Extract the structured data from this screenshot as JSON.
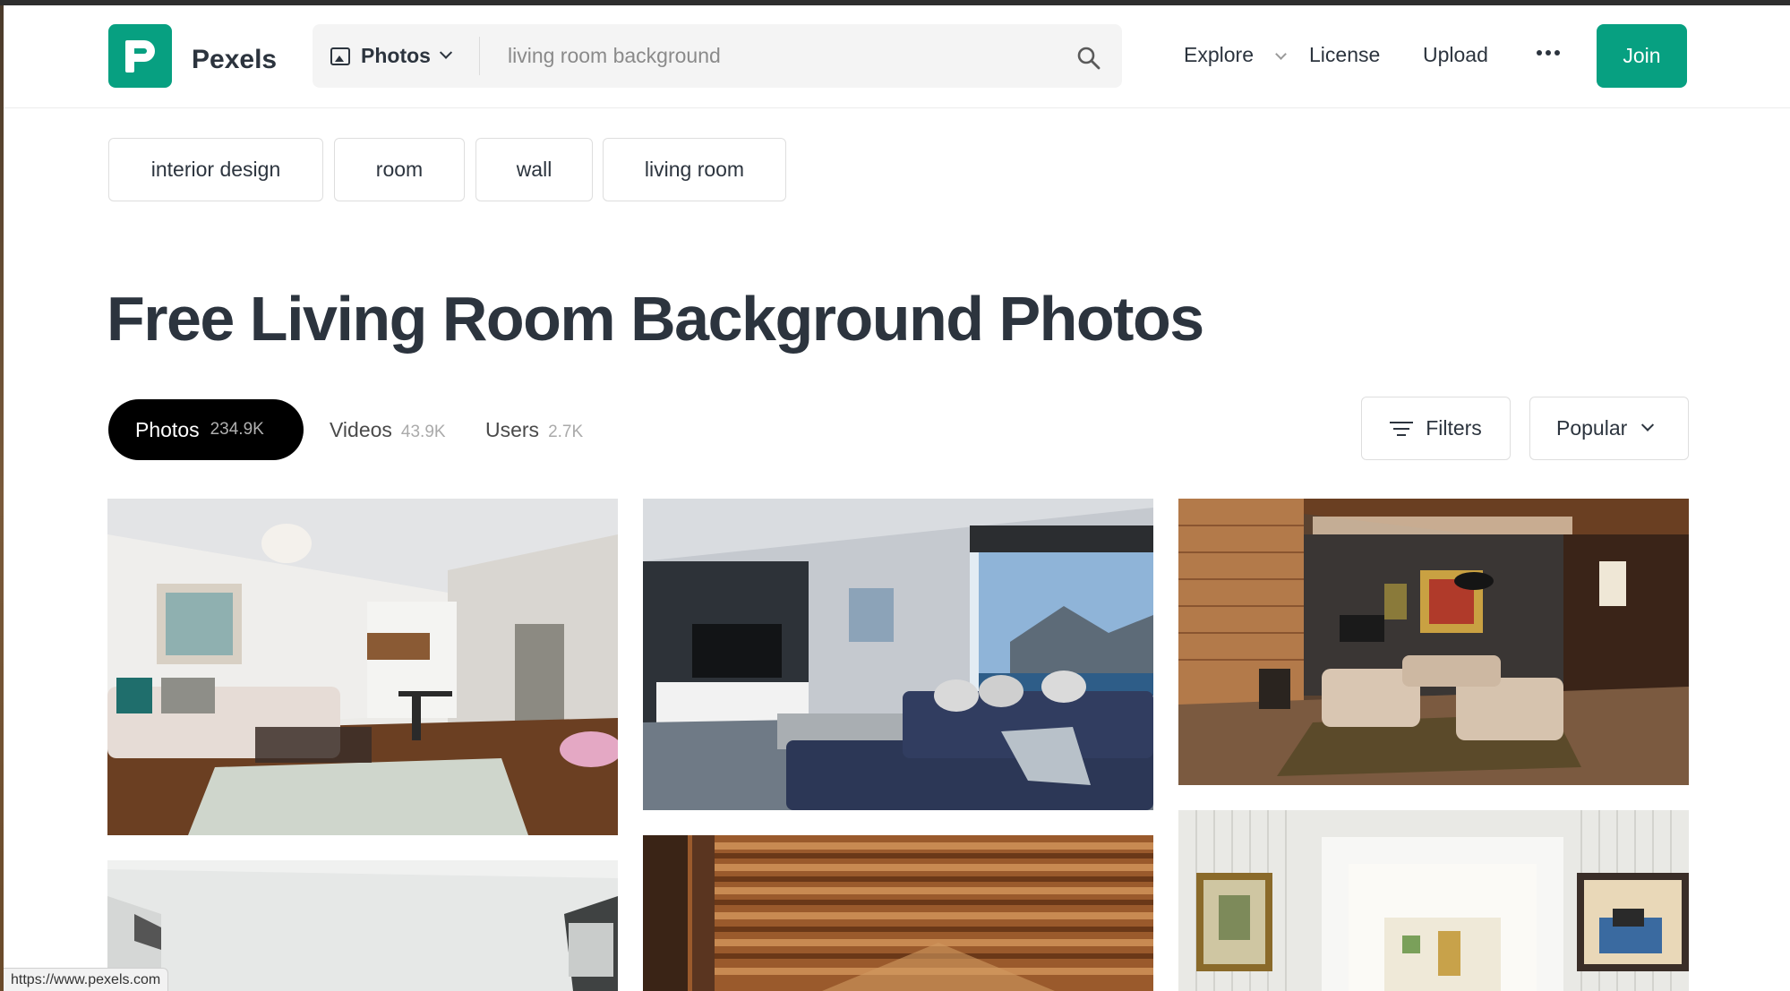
{
  "brand": {
    "name": "Pexels",
    "accent": "#07a081"
  },
  "search": {
    "type_label": "Photos",
    "value": "living room background"
  },
  "nav": {
    "explore": "Explore",
    "license": "License",
    "upload": "Upload",
    "join": "Join"
  },
  "related": [
    "interior design",
    "room",
    "wall",
    "living room"
  ],
  "page_title": "Free Living Room Background Photos",
  "tabs": [
    {
      "label": "Photos",
      "count": "234.9K",
      "active": true
    },
    {
      "label": "Videos",
      "count": "43.9K",
      "active": false
    },
    {
      "label": "Users",
      "count": "2.7K",
      "active": false
    }
  ],
  "filters_label": "Filters",
  "sort_label": "Popular",
  "photos": [
    {
      "subject": "bright-white-living-room-with-sectional-and-kitchen"
    },
    {
      "subject": "navy-sectional-living-room-with-ocean-view"
    },
    {
      "subject": "wood-paneled-living-room-with-beige-sofas"
    },
    {
      "subject": "white-room-with-blinds"
    },
    {
      "subject": "wooden-slatted-ceiling"
    },
    {
      "subject": "white-paneled-room-with-framed-pictures"
    }
  ],
  "status_url": "https://www.pexels.com"
}
